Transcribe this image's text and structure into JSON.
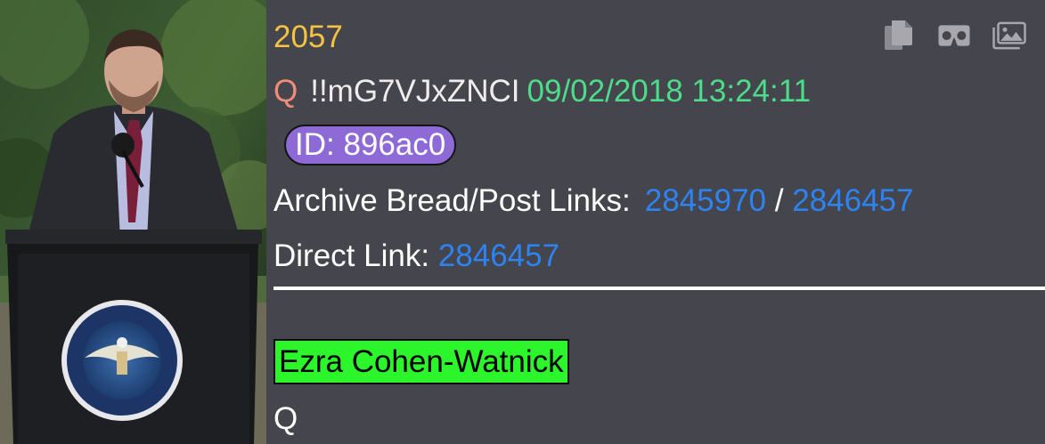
{
  "post": {
    "number": "2057",
    "author_name": "Q",
    "tripcode": "!!mG7VJxZNCI",
    "timestamp": "09/02/2018 13:24:11",
    "id_badge": "ID: 896ac0",
    "archive_label": "Archive Bread/Post Links:",
    "archive_bread_link": "2845970",
    "archive_separator": "/",
    "archive_post_link": "2846457",
    "direct_label": "Direct Link:",
    "direct_link": "2846457",
    "highlighted_text": "Ezra Cohen-Watnick",
    "signature": "Q"
  },
  "toolbar": {
    "icons": [
      "copy-icon",
      "vr-goggles-icon",
      "image-gallery-icon"
    ]
  },
  "colors": {
    "background": "#45454d",
    "post_number": "#f5c242",
    "author": "#f08d7a",
    "timestamp": "#4ddc8a",
    "id_badge": "#8d6ad6",
    "link": "#2c83f1",
    "highlight": "#2cf52c"
  }
}
